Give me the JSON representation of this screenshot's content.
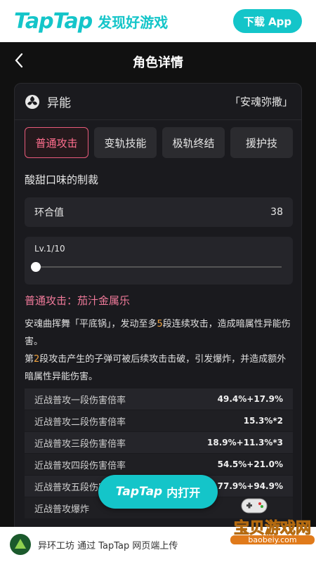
{
  "topbar": {
    "logo_text": "TapTap",
    "slogan": "发现好游戏",
    "download_label": "下载 App"
  },
  "header": {
    "title": "角色详情"
  },
  "card": {
    "type_label": "异能",
    "character_name": "「安魂弥撒」",
    "tabs": [
      {
        "label": "普通攻击",
        "active": true
      },
      {
        "label": "变轨技能",
        "active": false
      },
      {
        "label": "极轨终结",
        "active": false
      },
      {
        "label": "援护技",
        "active": false
      }
    ],
    "skill_name": "酸甜口味的制裁",
    "stat": {
      "label": "环合值",
      "value": "38"
    },
    "level": {
      "text": "Lv.1/10",
      "current": 1,
      "max": 10
    },
    "description": {
      "title": "普通攻击：茄汁金属乐",
      "p1_a": "安魂曲挥舞「平底锅」，发动至多",
      "p1_num": "5",
      "p1_b": "段连续攻击，造成暗属性异能伤害。",
      "p2_a": "第",
      "p2_num": "2",
      "p2_b": "段攻击产生的子弹可被后续攻击击破，引发爆炸，并造成额外暗属性异能伤害。"
    },
    "table": [
      {
        "label": "近战普攻一段伤害倍率",
        "value": "49.4%+17.9%"
      },
      {
        "label": "近战普攻二段伤害倍率",
        "value": "15.3%*2"
      },
      {
        "label": "近战普攻三段伤害倍率",
        "value": "18.9%+11.3%*3"
      },
      {
        "label": "近战普攻四段伤害倍率",
        "value": "54.5%+21.0%"
      },
      {
        "label": "近战普攻五段伤害倍率",
        "value": "77.9%+94.9%"
      },
      {
        "label": "近战普攻爆炸",
        "value": ""
      }
    ]
  },
  "open_button": {
    "brand": "TapTap",
    "label": "内打开"
  },
  "footer": {
    "text": "异环工坊 通过 TapTap 网页端上传"
  },
  "watermark": {
    "cn": "宝贝游戏网",
    "url": "baobeiy.com"
  },
  "colors": {
    "accent": "#14c5c9",
    "tab_active": "#e85a7a",
    "highlight": "#f0a340"
  }
}
